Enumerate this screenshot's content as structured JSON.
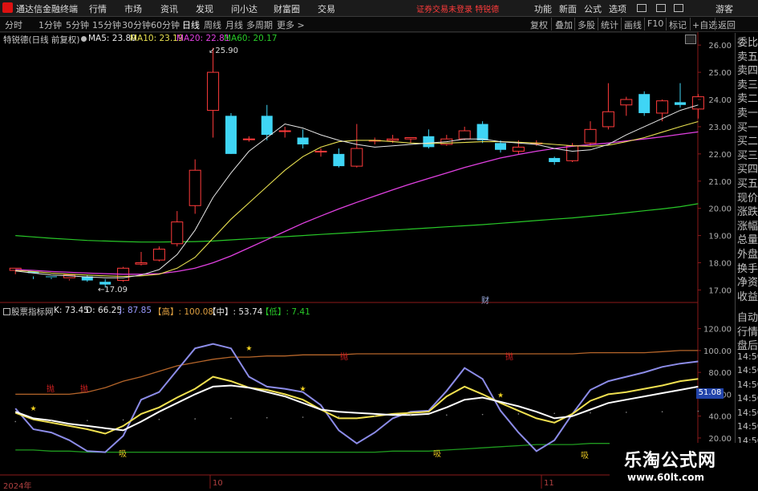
{
  "app": {
    "title": "通达信金融终端",
    "menu": [
      "行情",
      "市场",
      "资讯",
      "发现",
      "问小达",
      "财富圈",
      "交易"
    ],
    "broker_note": "证券交易未登录",
    "broker_name": "特锐德",
    "right_menu": [
      "功能",
      "新面",
      "公式",
      "选项"
    ],
    "user": "游客"
  },
  "periods": [
    "分时",
    "1分钟",
    "5分钟",
    "15分钟",
    "30分钟",
    "60分钟",
    "日线",
    "周线",
    "月线",
    "多周期",
    "更多 >"
  ],
  "active_period": "日线",
  "toolbar": [
    "复权",
    "叠加",
    "多股",
    "统计",
    "画线",
    "F10",
    "标记",
    "+自选",
    "返回"
  ],
  "main_info": {
    "stock": "特锐德(日线 前复权)",
    "ma5": "MA5: 23.80",
    "ma10": "MA10: 23.19",
    "ma20": "MA20: 22.81",
    "ma60": "MA60: 20.17"
  },
  "indicator_info": {
    "name": "股票指标网",
    "k": "K: 73.45",
    "d": "D: 66.25",
    "j": "J: 87.85",
    "high": "【高】: 100.08",
    "mid": "【中】: 53.74",
    "low": "【低】: 7.41"
  },
  "right_panel": [
    "委比",
    "卖五",
    "卖四",
    "卖三",
    "卖二",
    "卖一",
    "买一",
    "买二",
    "买三",
    "买四",
    "买五",
    "现价",
    "涨跌",
    "涨幅",
    "总量",
    "外盘",
    "换手",
    "净资",
    "收益"
  ],
  "right_panel_lower": [
    "自动",
    "行情",
    "盘后",
    "14:50",
    "14:50",
    "14:50",
    "14:50",
    "14:50",
    "14:50",
    "14:50"
  ],
  "price_axis": [
    "26.00",
    "25.00",
    "24.00",
    "23.00",
    "22.00",
    "21.00",
    "20.00",
    "19.00",
    "18.00",
    "17.00"
  ],
  "price_ticks": [
    26,
    25,
    24,
    23,
    22,
    21,
    20,
    19,
    18,
    17
  ],
  "price_range": [
    16.6,
    26.3
  ],
  "annotations": {
    "high": "25.90",
    "low": "17.09",
    "finance_mark": "财",
    "current_j": "51.08"
  },
  "indicator_axis": [
    "120.00",
    "100.00",
    "80.00",
    "60.00",
    "40.00",
    "20.00"
  ],
  "indicator_ticks": [
    120,
    100,
    80,
    60,
    40,
    20
  ],
  "indicator_range": [
    -5,
    130
  ],
  "date_labels": [
    "2024年",
    "10",
    "11"
  ],
  "signal_labels": {
    "buy": "吸",
    "sell": "抛"
  },
  "candles": [
    [
      17.72,
      17.8,
      17.58,
      17.7
    ],
    [
      17.68,
      17.62,
      17.4,
      17.5
    ],
    [
      17.5,
      17.48,
      17.4,
      17.45
    ],
    [
      17.45,
      17.55,
      17.35,
      17.4
    ],
    [
      17.5,
      17.35,
      17.3,
      17.55
    ],
    [
      17.3,
      17.2,
      17.09,
      17.4
    ],
    [
      17.35,
      17.8,
      17.3,
      17.85
    ],
    [
      17.95,
      18.0,
      17.9,
      18.4
    ],
    [
      18.1,
      18.5,
      18.05,
      18.6
    ],
    [
      18.7,
      19.5,
      18.6,
      19.9
    ],
    [
      20.1,
      21.4,
      19.8,
      21.8
    ],
    [
      23.6,
      25.0,
      22.6,
      25.9
    ],
    [
      23.4,
      22.0,
      22.0,
      23.5
    ],
    [
      22.55,
      22.55,
      22.45,
      22.65
    ],
    [
      23.4,
      22.7,
      22.5,
      23.8
    ],
    [
      22.85,
      22.85,
      22.6,
      23.0
    ],
    [
      22.6,
      22.35,
      22.2,
      22.9
    ],
    [
      22.1,
      22.1,
      21.9,
      22.2
    ],
    [
      22.0,
      21.55,
      21.5,
      22.2
    ],
    [
      21.55,
      22.2,
      21.5,
      23.1
    ],
    [
      22.5,
      22.5,
      22.35,
      22.6
    ],
    [
      22.5,
      22.55,
      22.4,
      22.7
    ],
    [
      22.55,
      22.6,
      22.4,
      22.6
    ],
    [
      22.65,
      22.25,
      22.2,
      22.9
    ],
    [
      22.35,
      22.55,
      22.3,
      22.7
    ],
    [
      22.55,
      22.85,
      22.5,
      23.0
    ],
    [
      23.1,
      22.5,
      22.4,
      23.2
    ],
    [
      22.4,
      22.15,
      22.05,
      22.5
    ],
    [
      22.1,
      22.25,
      22.0,
      22.5
    ],
    [
      22.4,
      22.4,
      22.3,
      22.5
    ],
    [
      21.85,
      21.7,
      21.6,
      21.9
    ],
    [
      21.75,
      22.3,
      21.7,
      22.4
    ],
    [
      22.4,
      22.9,
      22.3,
      23.2
    ],
    [
      23.0,
      23.55,
      22.9,
      24.6
    ],
    [
      23.8,
      24.0,
      23.4,
      24.1
    ],
    [
      24.2,
      23.5,
      23.4,
      24.3
    ],
    [
      23.5,
      23.95,
      23.2,
      24.0
    ],
    [
      23.9,
      23.8,
      23.7,
      24.6
    ],
    [
      23.65,
      24.1,
      23.3,
      24.2
    ]
  ],
  "ma5": [
    17.7,
    17.62,
    17.55,
    17.52,
    17.48,
    17.45,
    17.45,
    17.55,
    17.75,
    18.3,
    19.2,
    20.4,
    21.3,
    22.1,
    22.6,
    23.1,
    22.95,
    22.7,
    22.5,
    22.35,
    22.25,
    22.3,
    22.35,
    22.4,
    22.45,
    22.55,
    22.55,
    22.45,
    22.4,
    22.35,
    22.2,
    22.1,
    22.15,
    22.35,
    22.7,
    23.0,
    23.3,
    23.6,
    23.8
  ],
  "ma10": [
    17.72,
    17.68,
    17.62,
    17.58,
    17.55,
    17.52,
    17.5,
    17.52,
    17.58,
    17.8,
    18.2,
    18.9,
    19.6,
    20.2,
    20.8,
    21.4,
    21.9,
    22.25,
    22.45,
    22.5,
    22.5,
    22.45,
    22.4,
    22.38,
    22.4,
    22.42,
    22.45,
    22.45,
    22.43,
    22.4,
    22.35,
    22.3,
    22.28,
    22.32,
    22.45,
    22.6,
    22.8,
    23.0,
    23.19
  ],
  "ma20": [
    17.75,
    17.72,
    17.68,
    17.65,
    17.62,
    17.6,
    17.58,
    17.58,
    17.6,
    17.68,
    17.8,
    18.0,
    18.25,
    18.55,
    18.85,
    19.15,
    19.45,
    19.72,
    19.98,
    20.22,
    20.45,
    20.68,
    20.9,
    21.1,
    21.3,
    21.5,
    21.68,
    21.85,
    21.98,
    22.1,
    22.2,
    22.28,
    22.34,
    22.4,
    22.48,
    22.55,
    22.63,
    22.72,
    22.81
  ],
  "ma60": [
    19.0,
    18.95,
    18.9,
    18.86,
    18.82,
    18.8,
    18.78,
    18.76,
    18.76,
    18.77,
    18.78,
    18.8,
    18.84,
    18.88,
    18.92,
    18.96,
    19.0,
    19.04,
    19.08,
    19.12,
    19.16,
    19.2,
    19.24,
    19.28,
    19.32,
    19.36,
    19.4,
    19.45,
    19.5,
    19.55,
    19.6,
    19.65,
    19.71,
    19.77,
    19.84,
    19.91,
    19.98,
    20.06,
    20.17
  ],
  "ind_white": [
    44,
    38,
    36,
    33,
    31,
    29,
    27,
    35,
    44,
    52,
    60,
    67,
    68,
    66,
    62,
    58,
    52,
    46,
    44,
    43,
    42,
    41,
    41,
    42,
    48,
    55,
    57,
    53,
    49,
    44,
    38,
    40,
    46,
    52,
    55,
    58,
    61,
    64,
    67
  ],
  "ind_yellow": [
    43,
    37,
    34,
    31,
    28,
    24,
    31,
    42,
    48,
    57,
    65,
    76,
    72,
    66,
    64,
    60,
    55,
    46,
    38,
    38,
    40,
    42,
    43,
    44,
    58,
    67,
    60,
    52,
    45,
    38,
    34,
    42,
    54,
    60,
    62,
    65,
    68,
    72,
    74
  ],
  "ind_purple": [
    47,
    28,
    25,
    18,
    8,
    7,
    22,
    55,
    62,
    82,
    102,
    106,
    102,
    76,
    67,
    65,
    62,
    50,
    27,
    15,
    25,
    38,
    44,
    45,
    63,
    84,
    74,
    45,
    25,
    8,
    18,
    42,
    64,
    72,
    76,
    80,
    85,
    88,
    90
  ],
  "ind_orange": [
    60,
    60,
    60,
    60,
    62,
    66,
    72,
    76,
    81,
    86,
    89,
    92,
    94,
    94,
    95,
    95,
    96,
    96,
    96,
    97,
    97,
    97,
    97,
    97,
    97,
    97,
    97,
    97,
    97,
    97,
    97,
    97,
    98,
    98,
    98,
    98,
    99,
    100,
    100
  ],
  "ind_green": [
    9,
    9,
    8,
    8,
    7,
    7,
    7,
    7,
    7,
    7,
    7,
    7,
    7,
    7,
    7,
    7,
    7,
    7,
    7,
    7,
    7,
    8,
    8,
    8,
    9,
    10,
    11,
    12,
    13,
    14,
    14,
    14,
    15,
    15,
    15,
    15,
    15,
    15,
    15
  ],
  "colors": {
    "up": "#ff3b3b",
    "down": "#3fd5f5",
    "ma5": "#e8e8e8",
    "ma10": "#e8e050",
    "ma20": "#e040e0",
    "ma60": "#28c828"
  }
}
